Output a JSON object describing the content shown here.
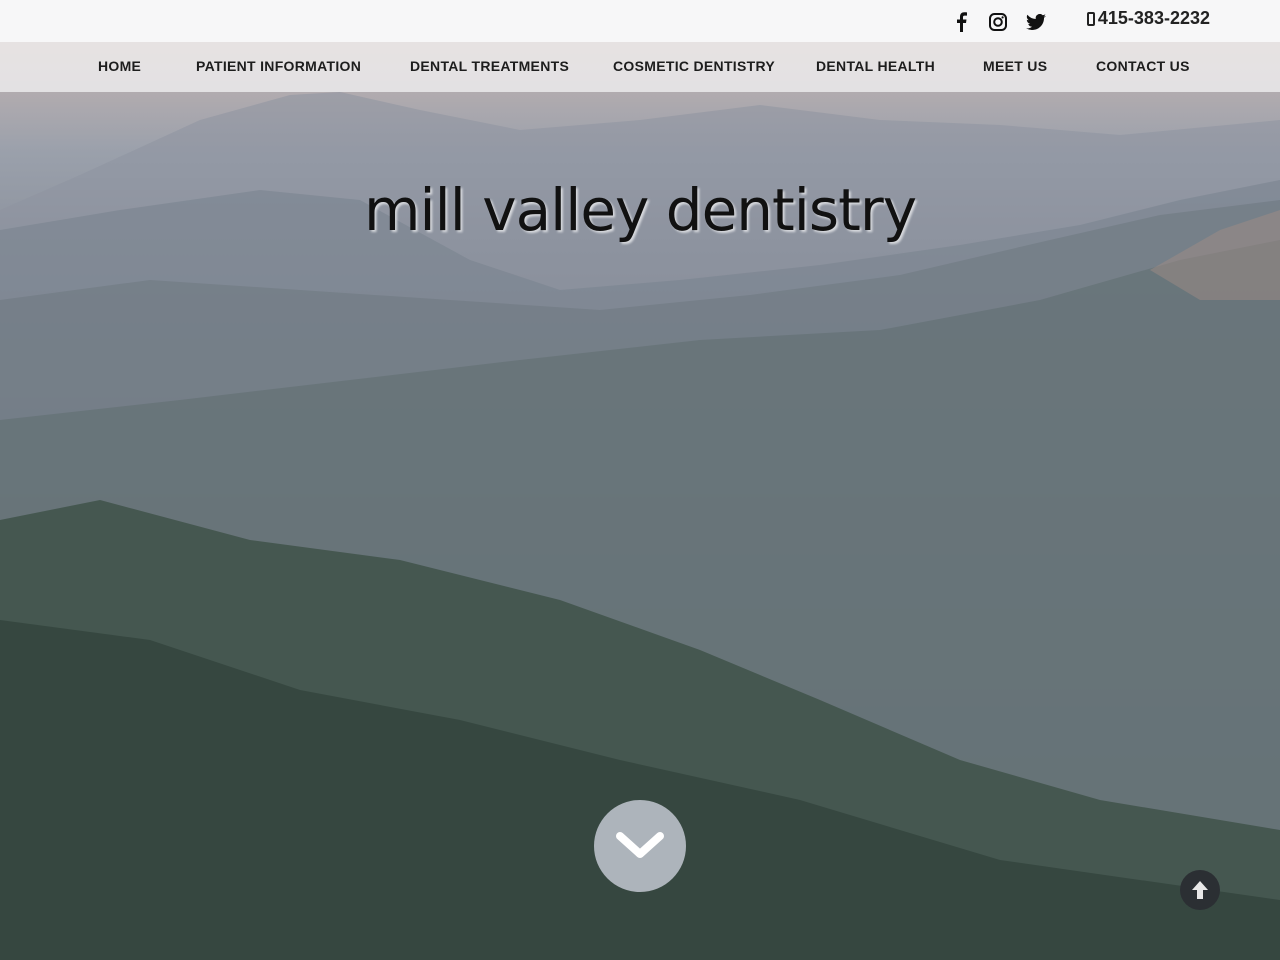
{
  "header": {
    "phone": "415-383-2232",
    "social_icons": [
      "facebook-icon",
      "instagram-icon",
      "twitter-icon"
    ]
  },
  "nav": {
    "items": [
      {
        "label": "HOME"
      },
      {
        "label": "PATIENT INFORMATION"
      },
      {
        "label": "DENTAL TREATMENTS"
      },
      {
        "label": "COSMETIC DENTISTRY"
      },
      {
        "label": "DENTAL HEALTH"
      },
      {
        "label": "MEET US"
      },
      {
        "label": "CONTACT US"
      }
    ]
  },
  "hero": {
    "title": "mill valley dentistry",
    "scroll_icon": "chevron-down-icon",
    "back_to_top_icon": "arrow-up-icon"
  },
  "colors": {
    "topbar_bg": "#f7f7f8",
    "text_dark": "#1d1d1d",
    "back_to_top_bg": "#2b2f33"
  }
}
